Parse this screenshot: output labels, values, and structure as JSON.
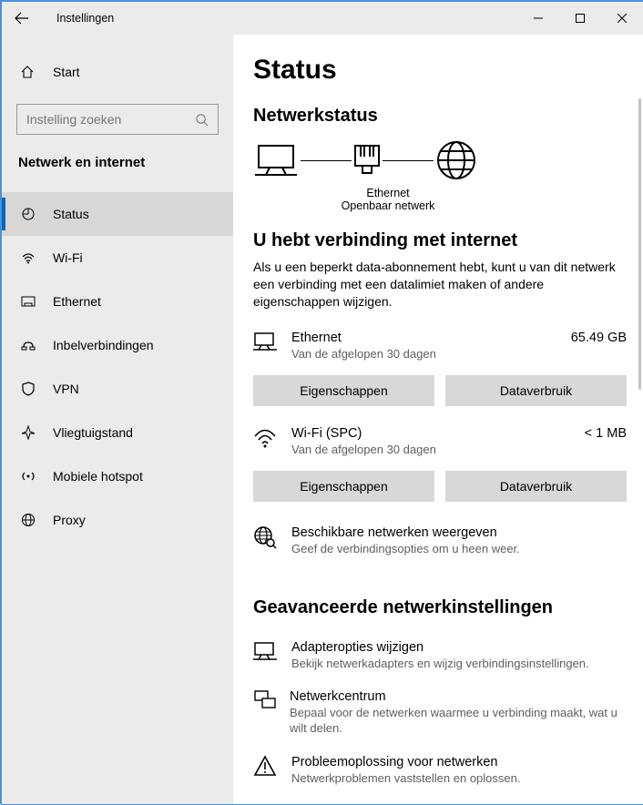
{
  "window": {
    "title": "Instellingen"
  },
  "sidebar": {
    "home": "Start",
    "search_placeholder": "Instelling zoeken",
    "group_title": "Netwerk en internet",
    "items": [
      {
        "label": "Status",
        "selected": true,
        "icon": "status"
      },
      {
        "label": "Wi-Fi",
        "selected": false,
        "icon": "wifi"
      },
      {
        "label": "Ethernet",
        "selected": false,
        "icon": "ethernet"
      },
      {
        "label": "Inbelverbindingen",
        "selected": false,
        "icon": "dialup"
      },
      {
        "label": "VPN",
        "selected": false,
        "icon": "vpn"
      },
      {
        "label": "Vliegtuigstand",
        "selected": false,
        "icon": "airplane"
      },
      {
        "label": "Mobiele hotspot",
        "selected": false,
        "icon": "hotspot"
      },
      {
        "label": "Proxy",
        "selected": false,
        "icon": "proxy"
      }
    ]
  },
  "page": {
    "title": "Status",
    "section_network_status": "Netwerkstatus",
    "diagram": {
      "mid_label_top": "Ethernet",
      "mid_label_bottom": "Openbaar netwerk"
    },
    "connected_heading": "U hebt verbinding met internet",
    "connected_para": "Als u een beperkt data-abonnement hebt, kunt u van dit netwerk een verbinding met een datalimiet maken of andere eigenschappen wijzigen.",
    "connections": [
      {
        "name": "Ethernet",
        "subtitle": "Van de afgelopen 30 dagen",
        "value": "65.49 GB",
        "icon": "ethernet"
      },
      {
        "name": "Wi-Fi (SPC)",
        "subtitle": "Van de afgelopen 30 dagen",
        "value": "< 1 MB",
        "icon": "wifi"
      }
    ],
    "btn_properties": "Eigenschappen",
    "btn_datausage": "Dataverbruik",
    "link_show_networks": {
      "title": "Beschikbare netwerken weergeven",
      "subtitle": "Geef de verbindingsopties om u heen weer."
    },
    "section_advanced": "Geavanceerde netwerkinstellingen",
    "adv_links": [
      {
        "title": "Adapteropties wijzigen",
        "subtitle": "Bekijk netwerkadapters en wijzig verbindingsinstellingen.",
        "icon": "adapters"
      },
      {
        "title": "Netwerkcentrum",
        "subtitle": "Bepaal voor de netwerken waarmee u verbinding maakt, wat u wilt delen.",
        "icon": "sharing"
      },
      {
        "title": "Probleemoplossing voor netwerken",
        "subtitle": "Netwerkproblemen vaststellen en oplossen.",
        "icon": "troubleshoot"
      }
    ]
  }
}
